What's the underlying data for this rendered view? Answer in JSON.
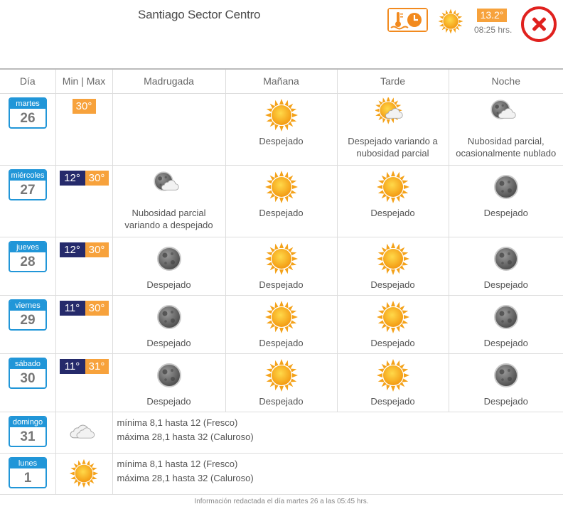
{
  "header": {
    "location": "Santiago Sector Centro",
    "current_temp": "13.2°",
    "current_time": "08:25 hrs."
  },
  "columns": [
    "Día",
    "Min | Max",
    "Madrugada",
    "Mañana",
    "Tarde",
    "Noche"
  ],
  "days": [
    {
      "name": "martes",
      "num": "26",
      "min": "",
      "max": "30°",
      "periods": [
        {
          "icon": "",
          "text": ""
        },
        {
          "icon": "sun",
          "text": "Despejado"
        },
        {
          "icon": "sun-cloud",
          "text": "Despejado variando a nubosidad parcial"
        },
        {
          "icon": "moon-cloud",
          "text": "Nubosidad parcial, ocasionalmente nublado"
        }
      ]
    },
    {
      "name": "miércoles",
      "num": "27",
      "min": "12°",
      "max": "30°",
      "periods": [
        {
          "icon": "moon-cloud",
          "text": "Nubosidad parcial variando a despejado"
        },
        {
          "icon": "sun",
          "text": "Despejado"
        },
        {
          "icon": "sun",
          "text": "Despejado"
        },
        {
          "icon": "moon",
          "text": "Despejado"
        }
      ]
    },
    {
      "name": "jueves",
      "num": "28",
      "min": "12°",
      "max": "30°",
      "periods": [
        {
          "icon": "moon",
          "text": "Despejado"
        },
        {
          "icon": "sun",
          "text": "Despejado"
        },
        {
          "icon": "sun",
          "text": "Despejado"
        },
        {
          "icon": "moon",
          "text": "Despejado"
        }
      ]
    },
    {
      "name": "viernes",
      "num": "29",
      "min": "11°",
      "max": "30°",
      "periods": [
        {
          "icon": "moon",
          "text": "Despejado"
        },
        {
          "icon": "sun",
          "text": "Despejado"
        },
        {
          "icon": "sun",
          "text": "Despejado"
        },
        {
          "icon": "moon",
          "text": "Despejado"
        }
      ]
    },
    {
      "name": "sábado",
      "num": "30",
      "min": "11°",
      "max": "31°",
      "periods": [
        {
          "icon": "moon",
          "text": "Despejado"
        },
        {
          "icon": "sun",
          "text": "Despejado"
        },
        {
          "icon": "sun",
          "text": "Despejado"
        },
        {
          "icon": "moon",
          "text": "Despejado"
        }
      ]
    }
  ],
  "extended": [
    {
      "name": "domingo",
      "num": "31",
      "icon": "clouds",
      "min_text": "mínima 8,1 hasta 12 (Fresco)",
      "max_text": "máxima 28,1 hasta 32 (Caluroso)"
    },
    {
      "name": "lunes",
      "num": "1",
      "icon": "sun",
      "min_text": "mínima 8,1 hasta 12 (Fresco)",
      "max_text": "máxima 28,1 hasta 32 (Caluroso)"
    }
  ],
  "footer": "Información redactada el día martes 26 a las 05:45 hrs.",
  "colors": {
    "accent_orange": "#f7a23c",
    "date_blue": "#2196d8",
    "min_navy": "#252a6b",
    "close_red": "#e0211e"
  }
}
